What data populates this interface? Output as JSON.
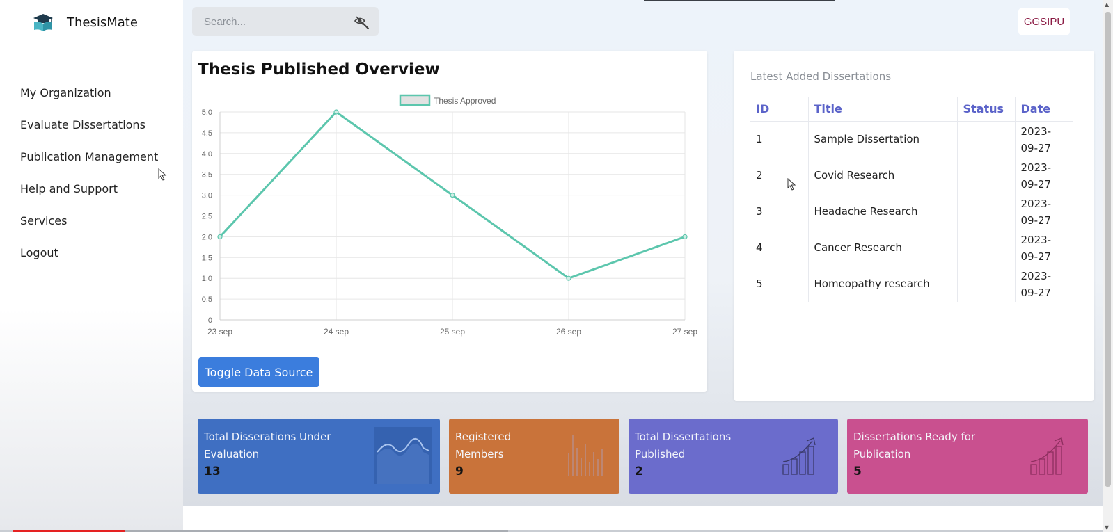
{
  "brand": {
    "name": "ThesisMate",
    "icon": "graduation-book-icon"
  },
  "sidebar": {
    "items": [
      {
        "label": "My Organization"
      },
      {
        "label": "Evaluate Dissertations"
      },
      {
        "label": "Publication Management"
      },
      {
        "label": "Help and Support"
      },
      {
        "label": "Services"
      },
      {
        "label": "Logout"
      }
    ]
  },
  "search": {
    "placeholder": "Search...",
    "icon": "search-icon"
  },
  "header": {
    "org": "GGSIPU"
  },
  "chart_card": {
    "title": "Thesis Published Overview",
    "toggle_label": "Toggle Data Source"
  },
  "chart_data": {
    "type": "line",
    "title": "Thesis Published Overview",
    "categories": [
      "23 sep",
      "24 sep",
      "25 sep",
      "26 sep",
      "27 sep"
    ],
    "series": [
      {
        "name": "Thesis Approved",
        "values": [
          2,
          5,
          3,
          1,
          2
        ],
        "color": "#5cc6ad"
      }
    ],
    "ylim": [
      0,
      5
    ],
    "yticks": [
      "0",
      "0.5",
      "1.0",
      "1.5",
      "2.0",
      "2.5",
      "3.0",
      "3.5",
      "4.0",
      "4.5",
      "5.0"
    ],
    "xlabel": "",
    "ylabel": "",
    "legend": "top-center",
    "grid": true
  },
  "dissertations": {
    "caption": "Latest Added Dissertations",
    "headers": {
      "id": "ID",
      "title": "Title",
      "status": "Status",
      "date": "Date"
    },
    "rows": [
      {
        "id": "1",
        "title": "Sample Dissertation",
        "status": "",
        "date_a": "2023-",
        "date_b": "09-27"
      },
      {
        "id": "2",
        "title": "Covid Research",
        "status": "",
        "date_a": "2023-",
        "date_b": "09-27"
      },
      {
        "id": "3",
        "title": "Headache Research",
        "status": "",
        "date_a": "2023-",
        "date_b": "09-27"
      },
      {
        "id": "4",
        "title": "Cancer Research",
        "status": "",
        "date_a": "2023-",
        "date_b": "09-27"
      },
      {
        "id": "5",
        "title": "Homeopathy research",
        "status": "",
        "date_a": "2023-",
        "date_b": "09-27"
      }
    ]
  },
  "stats": [
    {
      "line1": "Total Disserations Under",
      "line2": "Evaluation",
      "value": "13",
      "color": "#3f6fc2",
      "icon": "wave-chart-icon"
    },
    {
      "line1": "Registered",
      "line2": "Members",
      "value": "9",
      "color": "#c9733a",
      "icon": "bar-chart-icon"
    },
    {
      "line1": "Total Dissertations",
      "line2": "Published",
      "value": "2",
      "color": "#6b6ccc",
      "icon": "growth-chart-icon"
    },
    {
      "line1": "Dissertations Ready for",
      "line2": "Publication",
      "value": "5",
      "color": "#c9508f",
      "icon": "growth-chart-icon"
    }
  ],
  "video_progress": {
    "played": 0.1
  }
}
